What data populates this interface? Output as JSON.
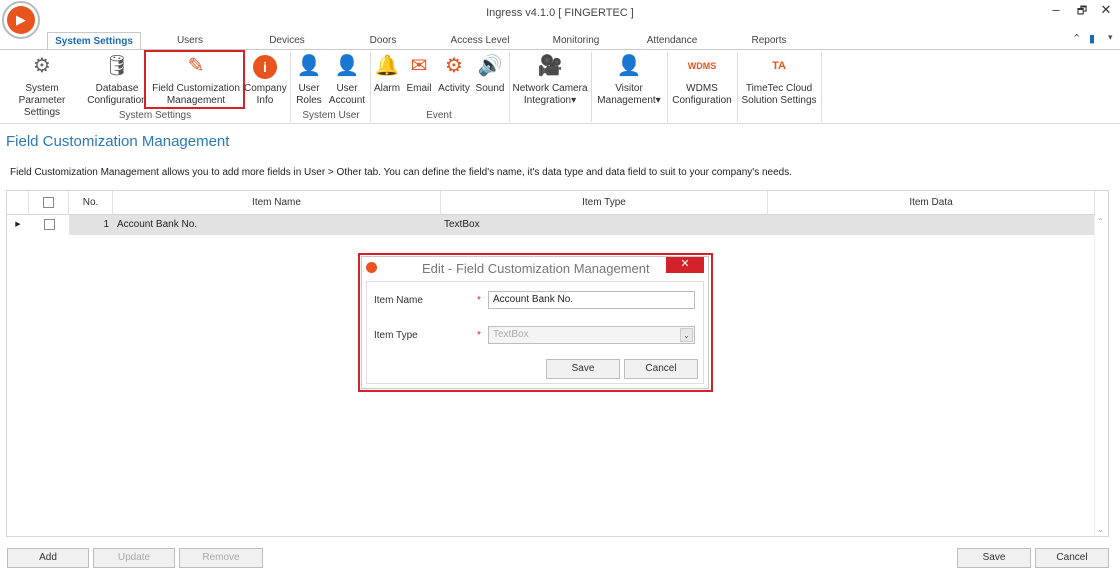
{
  "window": {
    "title": "Ingress v4.1.0 [ FINGERTEC ]",
    "minimize": "‒",
    "restore": "🗗",
    "close": "✕"
  },
  "tabs": [
    "System Settings",
    "Users",
    "Devices",
    "Doors",
    "Access Level",
    "Monitoring",
    "Attendance",
    "Reports"
  ],
  "ribbon": {
    "system_settings": {
      "group_label": "System Settings",
      "buttons": [
        {
          "label1": "System Parameter",
          "label2": "Settings"
        },
        {
          "label1": "Database",
          "label2": "Configuration"
        },
        {
          "label1": "Field Customization",
          "label2": "Management"
        },
        {
          "label1": "Company",
          "label2": "Info"
        }
      ]
    },
    "system_user": {
      "group_label": "System User",
      "buttons": [
        {
          "label1": "User",
          "label2": "Roles"
        },
        {
          "label1": "User",
          "label2": "Account"
        }
      ]
    },
    "event": {
      "group_label": "Event",
      "buttons": [
        "Alarm",
        "Email",
        "Activity",
        "Sound"
      ]
    },
    "others": [
      {
        "label1": "Network Camera",
        "label2": "Integration▾"
      },
      {
        "label1": "Visitor",
        "label2": "Management▾"
      },
      {
        "label1": "WDMS",
        "label2": "Configuration",
        "icon_text": "WDMS"
      },
      {
        "label1": "TimeTec Cloud",
        "label2": "Solution Settings",
        "icon_text": "TA"
      }
    ]
  },
  "page": {
    "title": "Field Customization Management",
    "description": "Field Customization Management allows you to add more fields in User > Other tab. You can define the field's name, it's data type and data field to suit to your company's needs."
  },
  "grid": {
    "columns": [
      "No.",
      "Item Name",
      "Item Type",
      "Item Data"
    ],
    "rows": [
      {
        "no": "1",
        "item_name": "Account Bank No.",
        "item_type": "TextBox",
        "item_data": ""
      }
    ]
  },
  "dialog": {
    "title": "Edit - Field Customization Management",
    "item_name_label": "Item Name",
    "item_name_value": "Account Bank No.",
    "item_type_label": "Item Type",
    "item_type_value": "TextBox",
    "required_mark": "*",
    "save": "Save",
    "cancel": "Cancel"
  },
  "footer": {
    "add": "Add",
    "update": "Update",
    "remove": "Remove",
    "save": "Save",
    "cancel": "Cancel"
  },
  "colors": {
    "accent": "#2b78b8",
    "highlight": "#d3222a",
    "icon_orange": "#e8541e"
  }
}
